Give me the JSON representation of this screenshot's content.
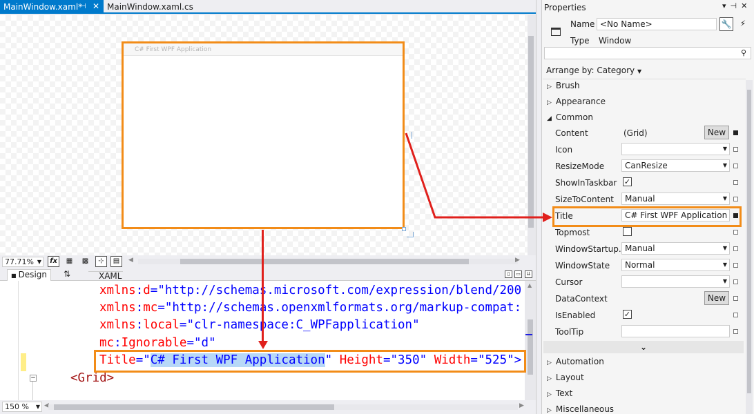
{
  "tabs": [
    {
      "label": "MainWindow.xaml*",
      "active": true
    },
    {
      "label": "MainWindow.xaml.cs",
      "active": false
    }
  ],
  "designer": {
    "window_title": "C# First WPF Application",
    "zoom": "77.71%",
    "fx_label": "fx"
  },
  "split": {
    "design_label": "Design",
    "xaml_label": "XAML"
  },
  "code": {
    "lines": [
      {
        "prefix": "xmlns",
        "ns": "d",
        "eq": "=",
        "value": "\"http://schemas.microsoft.com/expression/blend/200"
      },
      {
        "prefix": "xmlns",
        "ns": "mc",
        "eq": "=",
        "value": "\"http://schemas.openxmlformats.org/markup-compat:"
      },
      {
        "prefix": "xmlns",
        "ns": "local",
        "eq": "=",
        "value": "\"clr-namespace:C_WPFapplication\""
      },
      {
        "prefix": "mc",
        "ns": "Ignorable",
        "eq": "=",
        "value": "\"d\""
      }
    ],
    "title_attr": "Title",
    "title_value": "C# First WPF Application",
    "height_attr": "Height",
    "height_value": "\"350\"",
    "width_attr": "Width",
    "width_value": "\"525\"",
    "grid_tag": "<Grid>",
    "zoom": "150 %"
  },
  "properties": {
    "header": "Properties",
    "name_label": "Name",
    "name_value": "<No Name>",
    "type_label": "Type",
    "type_value": "Window",
    "arrange_by": "Arrange by: Category",
    "categories_top": [
      "Brush",
      "Appearance"
    ],
    "common_label": "Common",
    "rows": [
      {
        "label": "Content",
        "value": "(Grid)",
        "kind": "new"
      },
      {
        "label": "Icon",
        "value": "",
        "kind": "dropdown"
      },
      {
        "label": "ResizeMode",
        "value": "CanResize",
        "kind": "dropdown"
      },
      {
        "label": "ShowInTaskbar",
        "value": "✓",
        "kind": "check"
      },
      {
        "label": "SizeToContent",
        "value": "Manual",
        "kind": "dropdown"
      },
      {
        "label": "Title",
        "value": "C# First WPF Application",
        "kind": "text"
      },
      {
        "label": "Topmost",
        "value": "",
        "kind": "check"
      },
      {
        "label": "WindowStartup...",
        "value": "Manual",
        "kind": "dropdown"
      },
      {
        "label": "WindowState",
        "value": "Normal",
        "kind": "dropdown"
      },
      {
        "label": "Cursor",
        "value": "",
        "kind": "dropdown"
      },
      {
        "label": "DataContext",
        "value": "",
        "kind": "new"
      },
      {
        "label": "IsEnabled",
        "value": "✓",
        "kind": "check"
      },
      {
        "label": "ToolTip",
        "value": "",
        "kind": "text"
      }
    ],
    "new_label": "New",
    "categories_bottom": [
      "Automation",
      "Layout",
      "Text",
      "Miscellaneous"
    ]
  },
  "colors": {
    "accent": "#007acc",
    "highlight_box": "#f28c18",
    "arrow": "#e0201c"
  }
}
